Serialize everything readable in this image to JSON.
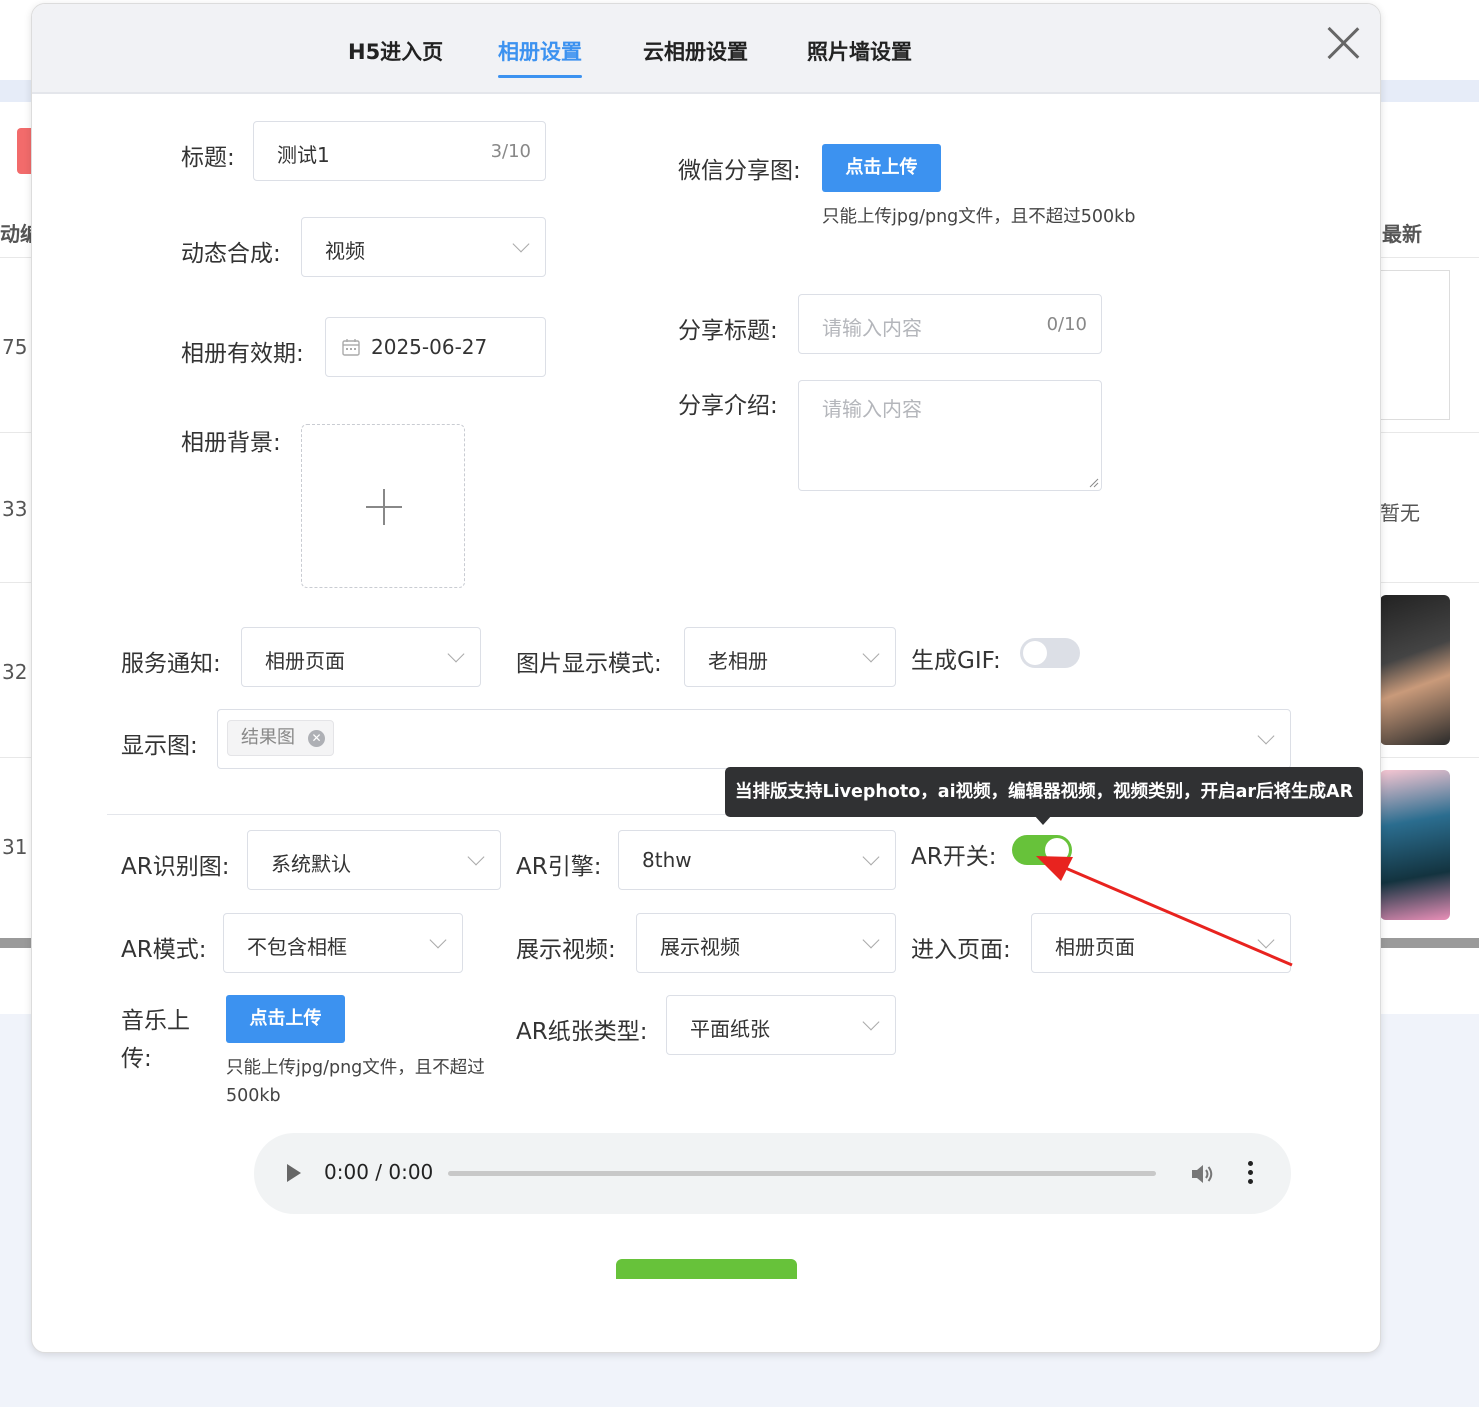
{
  "tabs": [
    {
      "label": "H5进入页"
    },
    {
      "label": "相册设置"
    },
    {
      "label": "云相册设置"
    },
    {
      "label": "照片墙设置"
    }
  ],
  "background": {
    "col_label_left": "动编号",
    "col_label_right": "最新",
    "row_ids": [
      "75",
      "33",
      "32",
      "31"
    ],
    "none_text": "暂无"
  },
  "form": {
    "title": {
      "label": "标题:",
      "value": "测试1",
      "count": "3/10"
    },
    "wechat_share_image": {
      "label": "微信分享图:",
      "button": "点击上传",
      "hint": "只能上传jpg/png文件，且不超过500kb"
    },
    "dynamic_synthesis": {
      "label": "动态合成:",
      "value": "视频"
    },
    "share_title": {
      "label": "分享标题:",
      "placeholder": "请输入内容",
      "count": "0/10"
    },
    "album_validity": {
      "label": "相册有效期:",
      "value": "2025-06-27"
    },
    "share_intro": {
      "label": "分享介绍:",
      "placeholder": "请输入内容"
    },
    "album_background": {
      "label": "相册背景:"
    },
    "service_notice": {
      "label": "服务通知:",
      "value": "相册页面"
    },
    "image_display_mode": {
      "label": "图片显示模式:",
      "value": "老相册"
    },
    "generate_gif": {
      "label": "生成GIF:",
      "on": false
    },
    "display_image": {
      "label": "显示图:",
      "tag": "结果图"
    },
    "tooltip": "当排版支持Livephoto，ai视频，编辑器视频，视频类别，开启ar后将生成AR",
    "ar_recognition_image": {
      "label": "AR识别图:",
      "value": "系统默认"
    },
    "ar_engine": {
      "label": "AR引擎:",
      "value": "8thw"
    },
    "ar_switch": {
      "label": "AR开关:",
      "on": true
    },
    "ar_mode": {
      "label": "AR模式:",
      "value": "不包含相框"
    },
    "display_video": {
      "label": "展示视频:",
      "value": "展示视频"
    },
    "enter_page": {
      "label": "进入页面:",
      "value": "相册页面"
    },
    "music_upload": {
      "label_line1": "音乐上",
      "label_line2": "传:",
      "button": "点击上传",
      "hint_line1": "只能上传jpg/png文件，且不超过",
      "hint_line2": "500kb"
    },
    "ar_paper_type": {
      "label": "AR纸张类型:",
      "value": "平面纸张"
    }
  },
  "audio": {
    "time": "0:00 / 0:00"
  },
  "colors": {
    "primary": "#3c92f0",
    "switch_on": "#67c23a",
    "switch_off": "#dcdfe6",
    "tooltip_bg": "#303133",
    "arrow": "#e8231f"
  }
}
